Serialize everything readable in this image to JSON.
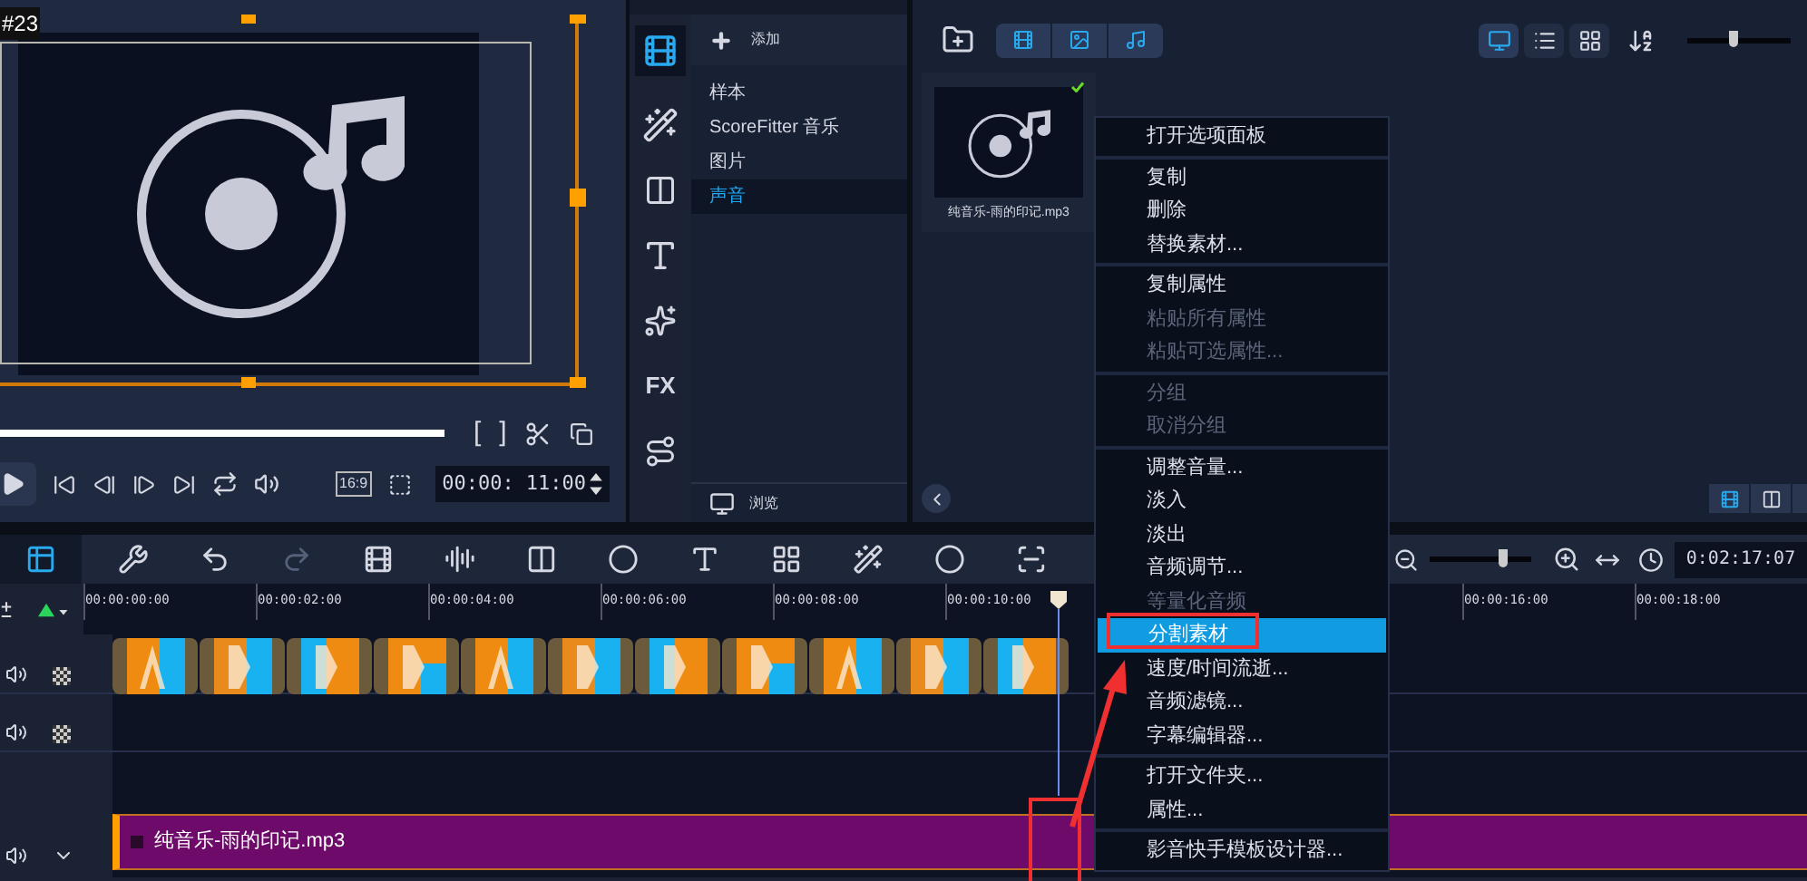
{
  "preview": {
    "frame_label": "#23",
    "mark_in": "[",
    "mark_out": "]",
    "aspect": "16:9",
    "timecode": "00:00: 11:00"
  },
  "library": {
    "fx_label": "FX",
    "add_label": "添加",
    "categories": [
      {
        "label": "样本",
        "selected": false
      },
      {
        "label": "ScoreFitter 音乐",
        "selected": false
      },
      {
        "label": "图片",
        "selected": false
      },
      {
        "label": "声音",
        "selected": true
      }
    ],
    "browse_label": "浏览",
    "views": [
      {
        "kind": "thumbnail",
        "selected": true
      },
      {
        "kind": "list",
        "selected": false
      },
      {
        "kind": "grid",
        "selected": false
      }
    ],
    "size_slider": {
      "level": 0.45
    },
    "media": [
      {
        "name": "纯音乐-雨的印记.mp3",
        "checked": true
      }
    ]
  },
  "timeline": {
    "total_time": "0:02:17:07",
    "zoom": {
      "level": 0.72
    },
    "ruler": [
      "00:00:00:00",
      "00:00:02:00",
      "00:00:04:00",
      "00:00:06:00",
      "00:00:08:00",
      "00:00:10:00"
    ],
    "ruler_right": [
      "00:00:16:00",
      "00:00:18:00"
    ],
    "video_clips": [
      {
        "kind": "picture"
      },
      {
        "kind": "picture"
      },
      {
        "kind": "picture"
      },
      {
        "kind": "picture"
      },
      {
        "kind": "picture"
      },
      {
        "kind": "picture"
      },
      {
        "kind": "picture"
      },
      {
        "kind": "picture"
      },
      {
        "kind": "picture"
      },
      {
        "kind": "picture"
      },
      {
        "kind": "picture"
      }
    ],
    "audio_clip": "纯音乐-雨的印记.mp3"
  },
  "context_menu": [
    [
      {
        "label": "打开选项面板",
        "disabled": false,
        "selected": false
      }
    ],
    [
      {
        "label": "复制",
        "disabled": false,
        "selected": false
      },
      {
        "label": "删除",
        "disabled": false,
        "selected": false
      },
      {
        "label": "替换素材...",
        "disabled": false,
        "selected": false
      }
    ],
    [
      {
        "label": "复制属性",
        "disabled": false,
        "selected": false
      },
      {
        "label": "粘贴所有属性",
        "disabled": true,
        "selected": false
      },
      {
        "label": "粘贴可选属性...",
        "disabled": true,
        "selected": false
      }
    ],
    [
      {
        "label": "分组",
        "disabled": true,
        "selected": false
      },
      {
        "label": "取消分组",
        "disabled": true,
        "selected": false
      }
    ],
    [
      {
        "label": "调整音量...",
        "disabled": false,
        "selected": false
      },
      {
        "label": "淡入",
        "disabled": false,
        "selected": false
      },
      {
        "label": "淡出",
        "disabled": false,
        "selected": false
      },
      {
        "label": "音频调节...",
        "disabled": false,
        "selected": false
      },
      {
        "label": "等量化音频",
        "disabled": true,
        "selected": false
      },
      {
        "label": "分割素材",
        "disabled": false,
        "selected": true
      },
      {
        "label": "速度/时间流逝...",
        "disabled": false,
        "selected": false
      },
      {
        "label": "音频滤镜...",
        "disabled": false,
        "selected": false
      },
      {
        "label": "字幕编辑器...",
        "disabled": false,
        "selected": false
      }
    ],
    [
      {
        "label": "打开文件夹...",
        "disabled": false,
        "selected": false
      },
      {
        "label": "属性...",
        "disabled": false,
        "selected": false
      }
    ],
    [
      {
        "label": "影音快手模板设计器...",
        "disabled": false,
        "selected": false
      }
    ]
  ]
}
